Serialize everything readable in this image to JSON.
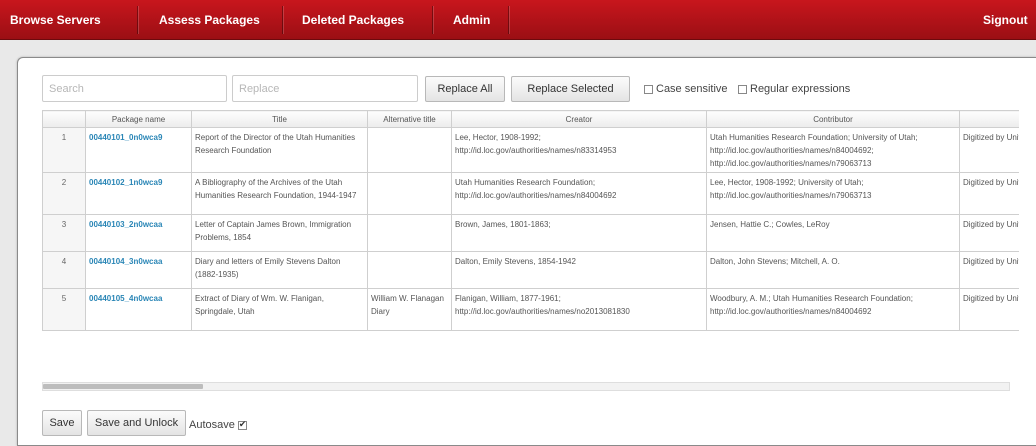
{
  "nav": {
    "items": [
      {
        "label": "Browse Servers"
      },
      {
        "label": "Assess Packages"
      },
      {
        "label": "Deleted Packages"
      },
      {
        "label": "Admin"
      }
    ],
    "signout": "Signout"
  },
  "toolbar": {
    "search_placeholder": "Search",
    "replace_placeholder": "Replace",
    "replace_all": "Replace All",
    "replace_selected": "Replace Selected",
    "case_sensitive": "Case sensitive",
    "regular_expressions": "Regular expressions",
    "case_sensitive_checked": false,
    "regular_expressions_checked": false
  },
  "grid": {
    "columns": [
      "",
      "Package name",
      "Title",
      "Alternative title",
      "Creator",
      "Contributor",
      ""
    ],
    "rows": [
      {
        "num": "1",
        "package": "00440101_0n0wca9",
        "title": "Report of the Director of the Utah Humanities Research Foundation",
        "alt_title": "",
        "creator": "Lee, Hector, 1908-1992; http://id.loc.gov/authorities/names/n83314953",
        "contributor": "Utah Humanities Research Foundation; University of Utah; http://id.loc.gov/authorities/names/n84004692; http://id.loc.gov/authorities/names/n79063713",
        "extra": "Digitized by University"
      },
      {
        "num": "2",
        "package": "00440102_1n0wca9",
        "title": "A Bibliography of the Archives of the Utah Humanities Research Foundation, 1944-1947",
        "alt_title": "",
        "creator": "Utah Humanities Research Foundation; http://id.loc.gov/authorities/names/n84004692",
        "contributor": "Lee, Hector, 1908-1992; University of Utah; http://id.loc.gov/authorities/names/n79063713",
        "extra": "Digitized by University"
      },
      {
        "num": "3",
        "package": "00440103_2n0wcaa",
        "title": "Letter of Captain James Brown, Immigration Problems, 1854",
        "alt_title": "",
        "creator": "Brown, James, 1801-1863;",
        "contributor": "Jensen, Hattie C.; Cowles, LeRoy",
        "extra": "Digitized by University"
      },
      {
        "num": "4",
        "package": "00440104_3n0wcaa",
        "title": "Diary and letters of Emily Stevens Dalton (1882-1935)",
        "alt_title": "",
        "creator": "Dalton, Emily Stevens, 1854-1942",
        "contributor": "Dalton, John Stevens; Mitchell, A. O.",
        "extra": "Digitized by University"
      },
      {
        "num": "5",
        "package": "00440105_4n0wcaa",
        "title": "Extract of Diary of Wm. W. Flanigan, Springdale, Utah",
        "alt_title": "William W. Flanagan Diary",
        "creator": "Flanigan, William, 1877-1961; http://id.loc.gov/authorities/names/no2013081830",
        "contributor": "Woodbury, A. M.; Utah Humanities Research Foundation; http://id.loc.gov/authorities/names/n84004692",
        "extra": "Digitized by University"
      }
    ]
  },
  "footer": {
    "save": "Save",
    "save_unlock": "Save and Unlock",
    "autosave": "Autosave",
    "autosave_checked": true
  }
}
